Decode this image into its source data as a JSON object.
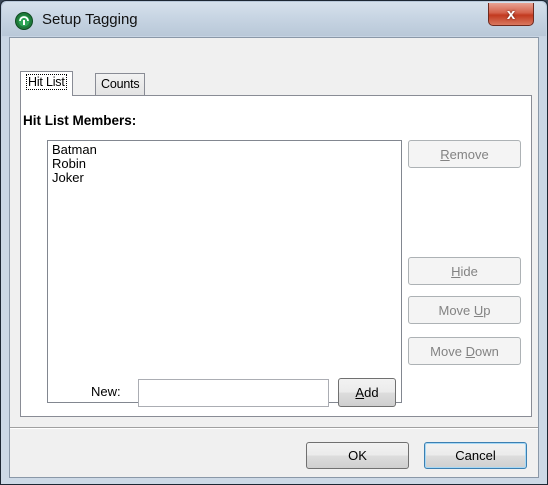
{
  "window": {
    "title": "Setup Tagging",
    "close_glyph": "x",
    "accent_close": "#c2391f"
  },
  "tabs": [
    {
      "label": "Hit List",
      "active": true
    },
    {
      "label": "Counts",
      "active": false
    }
  ],
  "hitlist": {
    "section_label": "Hit List Members:",
    "members": [
      "Batman",
      "Robin",
      "Joker"
    ],
    "remove": {
      "pre": "",
      "key": "R",
      "post": "emove"
    },
    "hide": {
      "pre": "",
      "key": "H",
      "post": "ide"
    },
    "move_up": {
      "pre": "Move ",
      "key": "U",
      "post": "p"
    },
    "move_down": {
      "pre": "Move ",
      "key": "D",
      "post": "own"
    },
    "new_label": "New:",
    "new_value": "",
    "add": {
      "pre": "",
      "key": "A",
      "post": "dd"
    }
  },
  "footer": {
    "ok_label": "OK",
    "cancel_label": "Cancel"
  },
  "icons": {
    "app": "app-logo-icon",
    "close": "close-icon"
  }
}
